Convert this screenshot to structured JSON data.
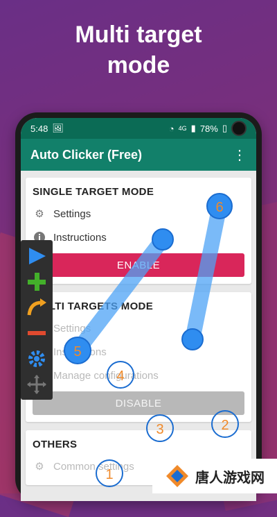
{
  "promo": {
    "line1": "Multi target",
    "line2": "mode"
  },
  "status": {
    "time": "5:48",
    "battery": "78%",
    "network": "4G"
  },
  "app": {
    "title": "Auto Clicker (Free)"
  },
  "single": {
    "title": "SINGLE TARGET MODE",
    "settings": "Settings",
    "instructions": "Instructions",
    "button": "ENABLE"
  },
  "multi": {
    "title": "MULTI TARGETS MODE",
    "settings": "Settings",
    "instructions": "Instructions",
    "manage": "Manage configurations",
    "button": "DISABLE"
  },
  "others": {
    "title": "OTHERS",
    "common": "Common settings"
  },
  "targets": [
    "1",
    "2",
    "3",
    "4",
    "5",
    "6"
  ],
  "logo": {
    "text": "唐人游戏网"
  },
  "colors": {
    "accent": "#12806a",
    "enable": "#d9265a",
    "target": "#2f8df0"
  }
}
